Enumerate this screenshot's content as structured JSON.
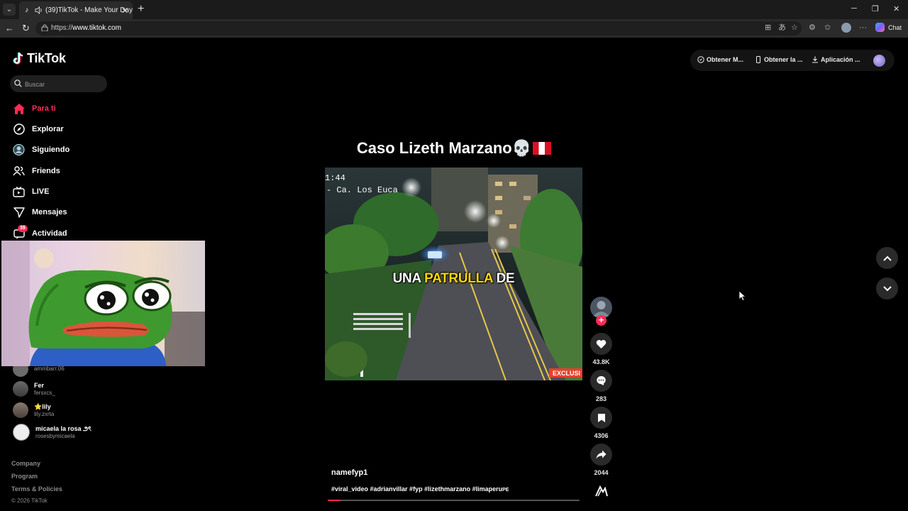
{
  "browser": {
    "tab_title": "(39)TikTok - Make Your Day",
    "url_scheme": "https://",
    "url_host": "www.tiktok.com",
    "chat_label": "Chat"
  },
  "brand": {
    "name": "TikTok"
  },
  "search": {
    "placeholder": "Buscar"
  },
  "nav": {
    "items": [
      {
        "label": "Para ti",
        "icon": "home-icon",
        "active": true
      },
      {
        "label": "Explorar",
        "icon": "compass-icon"
      },
      {
        "label": "Siguiendo",
        "icon": "following-avatar-icon"
      },
      {
        "label": "Friends",
        "icon": "friends-icon"
      },
      {
        "label": "LIVE",
        "icon": "live-icon"
      },
      {
        "label": "Mensajes",
        "icon": "send-icon"
      },
      {
        "label": "Actividad",
        "icon": "inbox-icon"
      }
    ],
    "activity_badge": "39"
  },
  "following_accounts": [
    {
      "name": "",
      "handle": "ammbarr.06"
    },
    {
      "name": "Fer",
      "handle": "fersxcs_"
    },
    {
      "name": "⭐lily",
      "handle": "lily.zxrta"
    },
    {
      "name": "micaela la rosa ౨ৎ",
      "handle": "rosesbymicaela"
    }
  ],
  "footer": {
    "links": [
      "Company",
      "Program",
      "Terms & Policies"
    ],
    "copyright": "© 2026 TikTok"
  },
  "topbar": {
    "buttons": [
      "Obtener M...",
      "Obtener la ...",
      "Aplicación ..."
    ]
  },
  "video": {
    "title": "Caso Lizeth Marzano💀",
    "timestamp": "1:44",
    "location": "- Ca. Los Euca",
    "caption_part1": "UNA ",
    "caption_highlight": "PATRULLA",
    "caption_part2": " DE",
    "corner_label": "EXCLUSI",
    "author": "namefyp1",
    "hashtags": "#viral_video #adrianvillar #fyp #lizethmarzano #limaperu",
    "hashtags_suffix": "PE",
    "progress": 0.05,
    "colors": {
      "accent": "#fe2c55",
      "caption_highlight": "#ffd800"
    }
  },
  "actions": {
    "likes": "43.8K",
    "comments": "283",
    "saves": "4306",
    "shares": "2044"
  }
}
